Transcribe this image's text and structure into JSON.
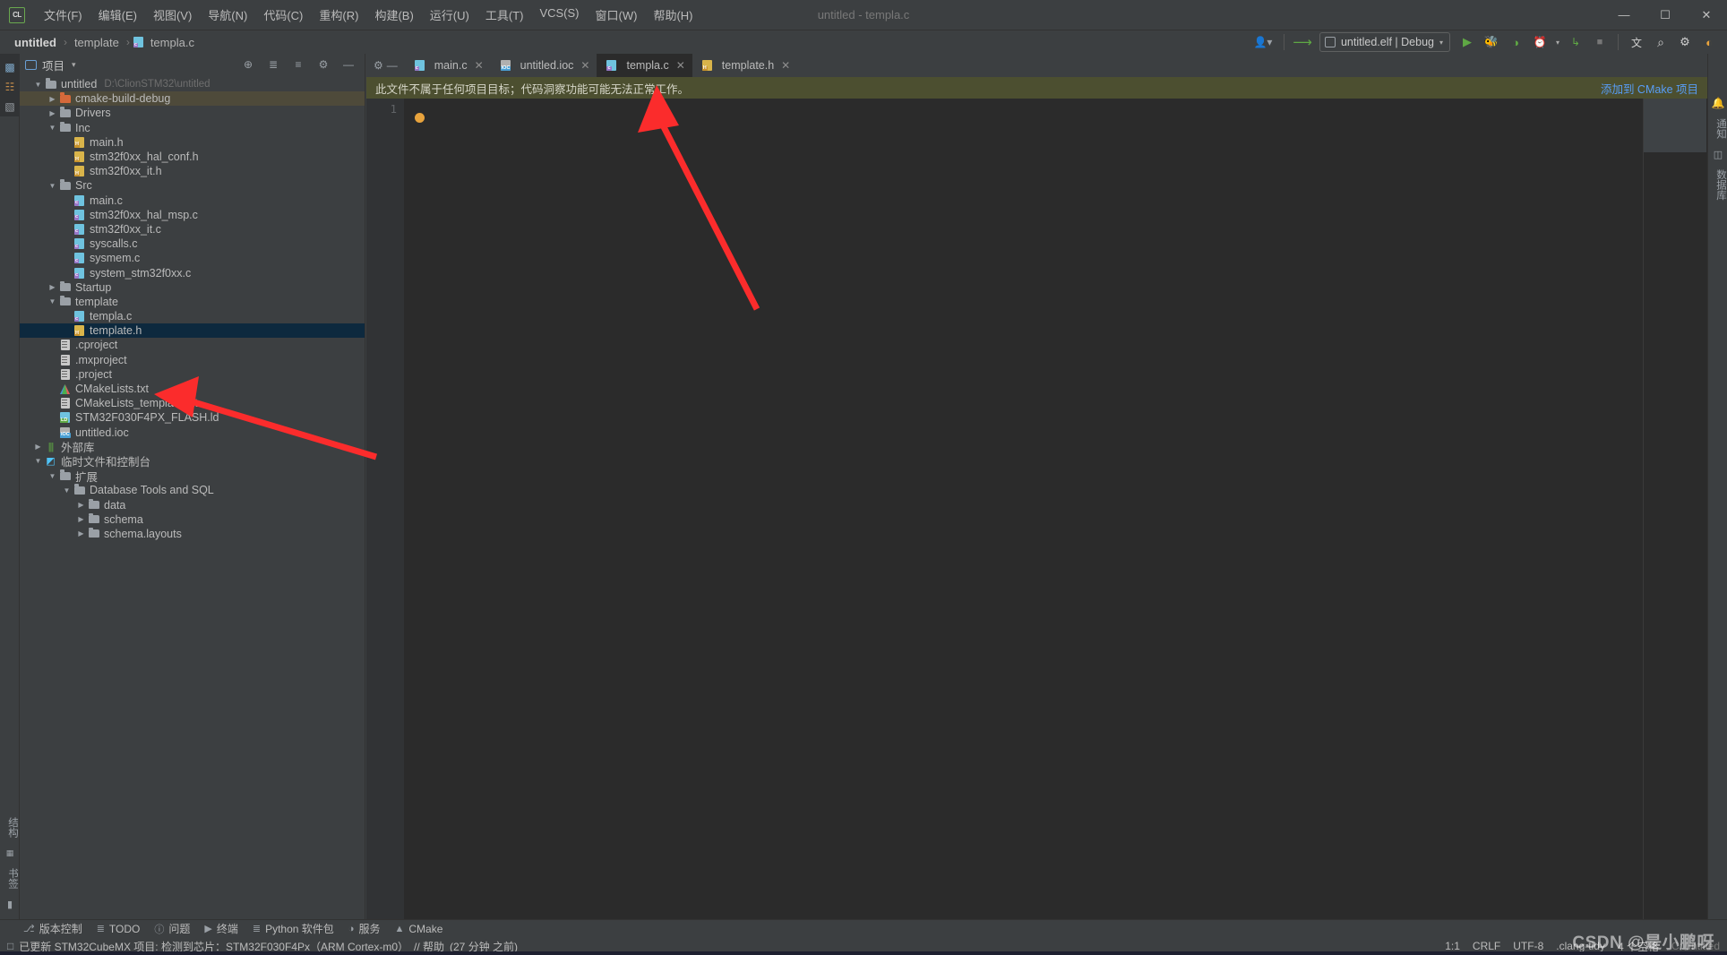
{
  "window": {
    "title": "untitled - templa.c",
    "logo_text": "CL",
    "controls": {
      "minimize": "—",
      "maximize": "☐",
      "close": "✕"
    }
  },
  "menu": [
    {
      "label": "文件(F)"
    },
    {
      "label": "编辑(E)"
    },
    {
      "label": "视图(V)"
    },
    {
      "label": "导航(N)"
    },
    {
      "label": "代码(C)"
    },
    {
      "label": "重构(R)"
    },
    {
      "label": "构建(B)"
    },
    {
      "label": "运行(U)"
    },
    {
      "label": "工具(T)"
    },
    {
      "label": "VCS(S)"
    },
    {
      "label": "窗口(W)"
    },
    {
      "label": "帮助(H)"
    }
  ],
  "breadcrumb": {
    "items": [
      {
        "label": "untitled",
        "bold": true
      },
      {
        "label": "template",
        "bold": false
      },
      {
        "label": "templa.c",
        "bold": false
      }
    ],
    "separator": "›"
  },
  "toolbar": {
    "run_config": "untitled.elf | Debug",
    "icons": [
      {
        "name": "user-avatar-icon",
        "glyph": "👤"
      },
      {
        "name": "build-hammer-icon",
        "glyph": "↖"
      },
      {
        "name": "run-icon",
        "glyph": "▶"
      },
      {
        "name": "debug-icon",
        "glyph": "🐞"
      },
      {
        "name": "run-with-coverage-icon",
        "glyph": "◑"
      },
      {
        "name": "profile-icon",
        "glyph": "◴"
      },
      {
        "name": "attach-process-icon",
        "glyph": "↳"
      },
      {
        "name": "stop-icon",
        "glyph": "■"
      },
      {
        "name": "translate-icon",
        "glyph": "文"
      },
      {
        "name": "search-everywhere-icon",
        "glyph": "⌕"
      },
      {
        "name": "settings-gear-icon",
        "glyph": "⚙"
      },
      {
        "name": "ide-feature-icon",
        "glyph": "◐"
      }
    ]
  },
  "left_rail": {
    "top_icons": [
      {
        "name": "project-view-icon",
        "glyph": "▥"
      },
      {
        "name": "commit-icon",
        "glyph": "⎇"
      },
      {
        "name": "folder-icon",
        "glyph": "▰"
      }
    ],
    "vtabs_top": [
      {
        "label": "项目"
      }
    ],
    "vtabs_bottom": [
      {
        "label": "结构",
        "icon": "structure-icon"
      },
      {
        "label": "书签",
        "icon": "bookmark-icon"
      }
    ]
  },
  "right_rail": {
    "vtabs": [
      {
        "label": "通知",
        "icon": "notifications-bell-icon"
      },
      {
        "label": "数据库",
        "icon": "database-icon"
      }
    ]
  },
  "project_panel": {
    "title": "项目",
    "caret": "▾",
    "actions": [
      {
        "name": "select-opened-file-icon",
        "glyph": "⊕"
      },
      {
        "name": "collapse-all-icon",
        "glyph": "≡"
      },
      {
        "name": "expand-all-icon",
        "glyph": "≣"
      },
      {
        "name": "panel-settings-icon",
        "glyph": "⚙"
      },
      {
        "name": "hide-panel-icon",
        "glyph": "—"
      }
    ],
    "tree": [
      {
        "indent": 0,
        "arrow": "down",
        "icon": "folder",
        "label": "untitled",
        "sub": "D:\\ClionSTM32\\untitled",
        "state": "normal"
      },
      {
        "indent": 1,
        "arrow": "right",
        "icon": "folder-orange",
        "label": "cmake-build-debug",
        "sub": "",
        "state": "highlight"
      },
      {
        "indent": 1,
        "arrow": "right",
        "icon": "folder",
        "label": "Drivers",
        "sub": "",
        "state": "normal"
      },
      {
        "indent": 1,
        "arrow": "down",
        "icon": "folder",
        "label": "Inc",
        "sub": "",
        "state": "normal"
      },
      {
        "indent": 2,
        "arrow": "none",
        "icon": "h-file",
        "label": "main.h",
        "sub": "",
        "state": "normal"
      },
      {
        "indent": 2,
        "arrow": "none",
        "icon": "h-file",
        "label": "stm32f0xx_hal_conf.h",
        "sub": "",
        "state": "normal"
      },
      {
        "indent": 2,
        "arrow": "none",
        "icon": "h-file",
        "label": "stm32f0xx_it.h",
        "sub": "",
        "state": "normal"
      },
      {
        "indent": 1,
        "arrow": "down",
        "icon": "folder",
        "label": "Src",
        "sub": "",
        "state": "normal"
      },
      {
        "indent": 2,
        "arrow": "none",
        "icon": "c-file",
        "label": "main.c",
        "sub": "",
        "state": "normal"
      },
      {
        "indent": 2,
        "arrow": "none",
        "icon": "c-file",
        "label": "stm32f0xx_hal_msp.c",
        "sub": "",
        "state": "normal"
      },
      {
        "indent": 2,
        "arrow": "none",
        "icon": "c-file",
        "label": "stm32f0xx_it.c",
        "sub": "",
        "state": "normal"
      },
      {
        "indent": 2,
        "arrow": "none",
        "icon": "c-file",
        "label": "syscalls.c",
        "sub": "",
        "state": "normal"
      },
      {
        "indent": 2,
        "arrow": "none",
        "icon": "c-file",
        "label": "sysmem.c",
        "sub": "",
        "state": "normal"
      },
      {
        "indent": 2,
        "arrow": "none",
        "icon": "c-file",
        "label": "system_stm32f0xx.c",
        "sub": "",
        "state": "normal"
      },
      {
        "indent": 1,
        "arrow": "right",
        "icon": "folder",
        "label": "Startup",
        "sub": "",
        "state": "normal"
      },
      {
        "indent": 1,
        "arrow": "down",
        "icon": "folder",
        "label": "template",
        "sub": "",
        "state": "normal"
      },
      {
        "indent": 2,
        "arrow": "none",
        "icon": "c-file",
        "label": "templa.c",
        "sub": "",
        "state": "normal"
      },
      {
        "indent": 2,
        "arrow": "none",
        "icon": "h-file",
        "label": "template.h",
        "sub": "",
        "state": "selected"
      },
      {
        "indent": 1,
        "arrow": "none",
        "icon": "txt-file",
        "label": ".cproject",
        "sub": "",
        "state": "normal"
      },
      {
        "indent": 1,
        "arrow": "none",
        "icon": "txt-file",
        "label": ".mxproject",
        "sub": "",
        "state": "normal"
      },
      {
        "indent": 1,
        "arrow": "none",
        "icon": "txt-file",
        "label": ".project",
        "sub": "",
        "state": "normal"
      },
      {
        "indent": 1,
        "arrow": "none",
        "icon": "cmake-file",
        "label": "CMakeLists.txt",
        "sub": "",
        "state": "normal"
      },
      {
        "indent": 1,
        "arrow": "none",
        "icon": "txt-file",
        "label": "CMakeLists_template.txt",
        "sub": "",
        "state": "normal"
      },
      {
        "indent": 1,
        "arrow": "none",
        "icon": "ld-file",
        "label": "STM32F030F4PX_FLASH.ld",
        "sub": "",
        "state": "normal"
      },
      {
        "indent": 1,
        "arrow": "none",
        "icon": "ioc-file",
        "label": "untitled.ioc",
        "sub": "",
        "state": "normal"
      },
      {
        "indent": 0,
        "arrow": "right",
        "icon": "library",
        "label": "外部库",
        "sub": "",
        "state": "normal"
      },
      {
        "indent": 0,
        "arrow": "down",
        "icon": "scratch",
        "label": "临时文件和控制台",
        "sub": "",
        "state": "normal"
      },
      {
        "indent": 1,
        "arrow": "down",
        "icon": "folder",
        "label": "扩展",
        "sub": "",
        "state": "normal"
      },
      {
        "indent": 2,
        "arrow": "down",
        "icon": "folder",
        "label": "Database Tools and SQL",
        "sub": "",
        "state": "normal"
      },
      {
        "indent": 3,
        "arrow": "right",
        "icon": "folder",
        "label": "data",
        "sub": "",
        "state": "normal"
      },
      {
        "indent": 3,
        "arrow": "right",
        "icon": "folder",
        "label": "schema",
        "sub": "",
        "state": "normal"
      },
      {
        "indent": 3,
        "arrow": "right",
        "icon": "folder",
        "label": "schema.layouts",
        "sub": "",
        "state": "normal"
      }
    ]
  },
  "editor": {
    "tabs": [
      {
        "label": "main.c",
        "icon": "c-file",
        "active": false
      },
      {
        "label": "untitled.ioc",
        "icon": "ioc-file",
        "active": false
      },
      {
        "label": "templa.c",
        "icon": "c-file",
        "active": true
      },
      {
        "label": "template.h",
        "icon": "h-file",
        "active": false
      }
    ],
    "tab_close_glyph": "✕",
    "notice": {
      "text": "此文件不属于任何项目目标；代码洞察功能可能无法正常工作。",
      "link": "添加到 CMake 项目"
    },
    "line_numbers": [
      "1"
    ],
    "content": "",
    "right_icons": [
      {
        "name": "inspections-off-icon",
        "glyph": "⊘"
      },
      {
        "name": "inspection-ok-icon",
        "glyph": "✓"
      }
    ]
  },
  "bottom_toolbar": [
    {
      "label": "版本控制",
      "icon": "⎇"
    },
    {
      "label": "TODO",
      "icon": "≣"
    },
    {
      "label": "问题",
      "icon": "ⓘ"
    },
    {
      "label": "终端",
      "icon": "▶"
    },
    {
      "label": "Python 软件包",
      "icon": "≣"
    },
    {
      "label": "服务",
      "icon": "◑"
    },
    {
      "label": "CMake",
      "icon": "▲"
    }
  ],
  "status_bar": {
    "message_icon": "□",
    "message": "已更新 STM32CubeMX 项目: 检测到芯片：STM32F030F4Px（ARM Cortex-m0）",
    "help_link": "// 帮助",
    "time": "(27 分钟 之前)",
    "right": [
      {
        "name": "caret-position",
        "label": "1:1"
      },
      {
        "name": "line-separator",
        "label": "CRLF"
      },
      {
        "name": "file-encoding",
        "label": "UTF-8"
      },
      {
        "name": "clang-tidy-status",
        "label": ".clang-tidy"
      },
      {
        "name": "indent-setting",
        "label": "4 个空格"
      },
      {
        "name": "toolchain-label",
        "label": "C: untitled"
      }
    ],
    "watermark": "CSDN @是小鹏呀"
  },
  "colors": {
    "accent_blue": "#589df6",
    "notice_bg": "#4c4f30",
    "selection_bg": "#0d293e",
    "panel_bg": "#3c3f41",
    "editor_bg": "#2b2b2b",
    "annotation_red": "#fb2c2c"
  }
}
